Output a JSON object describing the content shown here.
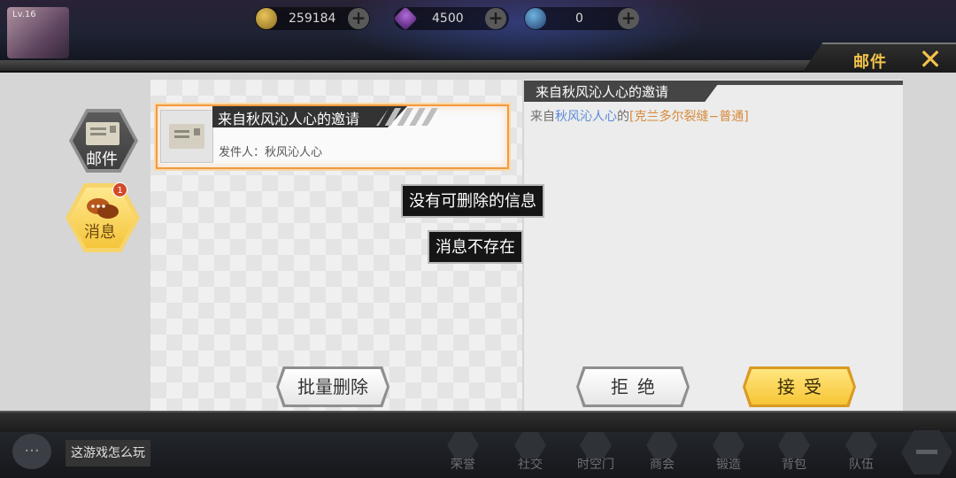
{
  "header": {
    "level": "Lv.16",
    "resources": [
      {
        "icon": "gold-coin-icon",
        "value": "259184"
      },
      {
        "icon": "purple-crystal-icon",
        "value": "4500"
      },
      {
        "icon": "blue-gem-icon",
        "value": "0"
      }
    ],
    "plus_symbol": "+"
  },
  "window": {
    "title": "邮件",
    "close_symbol": "✕"
  },
  "tabs": [
    {
      "label": "邮件",
      "icon": "mail-icon",
      "active": false
    },
    {
      "label": "消息",
      "icon": "chat-bubbles-icon",
      "active": true,
      "badge": "1"
    }
  ],
  "mail_list": [
    {
      "title": "来自秋风沁人心的邀请",
      "sender": "发件人：秋风沁人心"
    }
  ],
  "detail": {
    "title": "来自秋风沁人心的邀请",
    "body_prefix": "来自",
    "body_sender": "秋风沁人心",
    "body_mid": "的",
    "body_dungeon": "[克兰多尔裂缝−普通]"
  },
  "toasts": [
    "没有可删除的信息",
    "消息不存在"
  ],
  "buttons": {
    "batch_delete": "批量删除",
    "reject": "拒绝",
    "accept": "接受"
  },
  "footer": {
    "chat_hint": "这游戏怎么玩",
    "nav": [
      "荣誉",
      "社交",
      "时空门",
      "商会",
      "锻造",
      "背包",
      "队伍"
    ]
  },
  "colors": {
    "accent_gold": "#f3c34a",
    "selection_orange": "#f29a3e",
    "sender_link": "#5a8ad9",
    "dungeon_link": "#d68a3a"
  }
}
